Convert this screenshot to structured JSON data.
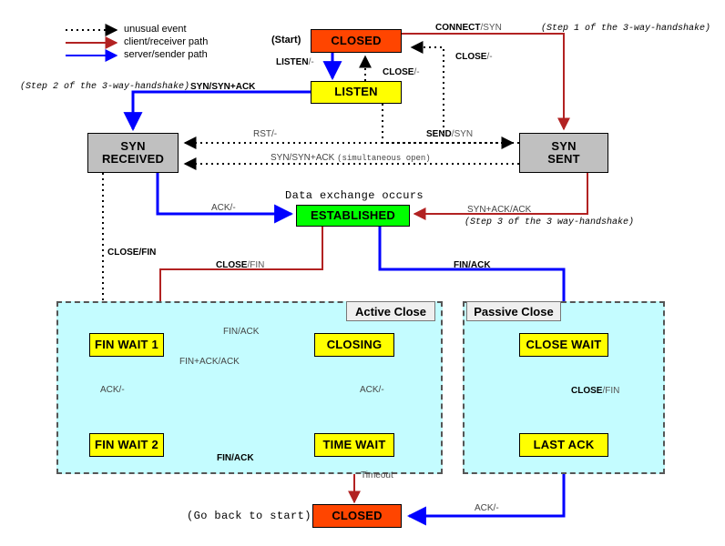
{
  "legend": {
    "items": [
      {
        "label": "unusual event",
        "style": "dotted",
        "color": "#000000"
      },
      {
        "label": "client/receiver path",
        "style": "solid",
        "color": "#B22222"
      },
      {
        "label": "server/sender path",
        "style": "solid",
        "color": "#0000FF"
      }
    ]
  },
  "colors": {
    "closed": "#FF4500",
    "listen": "#FFFF00",
    "gray": "#C0C0C0",
    "established": "#00FF00",
    "panel_bg": "#C4FCFF",
    "client_path": "#B22222",
    "server_path": "#0000FF",
    "unusual_event": "#000000"
  },
  "states": {
    "closed_top": "CLOSED",
    "listen": "LISTEN",
    "syn_received": "SYN\nRECEIVED",
    "syn_received_l1": "SYN",
    "syn_received_l2": "RECEIVED",
    "syn_sent_l1": "SYN",
    "syn_sent_l2": "SENT",
    "established": "ESTABLISHED",
    "fin_wait_1": "FIN WAIT 1",
    "fin_wait_2": "FIN WAIT 2",
    "closing": "CLOSING",
    "time_wait": "TIME WAIT",
    "close_wait": "CLOSE WAIT",
    "last_ack": "LAST ACK",
    "closed_bottom": "CLOSED"
  },
  "panels": {
    "active_close": "Active Close",
    "passive_close": "Passive Close"
  },
  "annotations": {
    "start": "(Start)",
    "data_exchange": "Data exchange occurs",
    "go_back": "(Go back to start)",
    "step1": "(Step 1 of the 3-way-handshake)",
    "step2": "(Step 2 of the 3-way-handshake)",
    "step3": "(Step 3 of the 3 way-handshake)",
    "simultaneous_open": "(simultaneous open)"
  },
  "transitions": {
    "connect_syn_event": "CONNECT",
    "connect_syn_action": "/SYN",
    "listen_dash_event": "LISTEN",
    "listen_dash_action": "/-",
    "close_dash_right_event": "CLOSE",
    "close_dash_right_action": "/-",
    "close_dash_mid_event": "CLOSE",
    "close_dash_mid_action": "/-",
    "syn_synack": "SYN/SYN+ACK",
    "rst_dash": "RST/-",
    "send_syn_event": "SEND",
    "send_syn_action": "/SYN",
    "syn_synack_sim": "SYN/SYN+ACK",
    "ack_dash_left": "ACK/-",
    "synack_ack": "SYN+ACK/ACK",
    "close_fin_left": "CLOSE/FIN",
    "close_fin_mid_event": "CLOSE",
    "close_fin_mid_action": "/FIN",
    "fin_ack_right": "FIN/ACK",
    "fin_ack_top": "FIN/ACK",
    "fin_ack_ack": "FIN+ACK/ACK",
    "ack_dash_fw1": "ACK/-",
    "ack_dash_closing": "ACK/-",
    "fin_ack_bottom": "FIN/ACK",
    "timeout": "Timeout",
    "close_fin_passive_event": "CLOSE",
    "close_fin_passive_action": "/FIN",
    "ack_dash_lastack": "ACK/-"
  }
}
